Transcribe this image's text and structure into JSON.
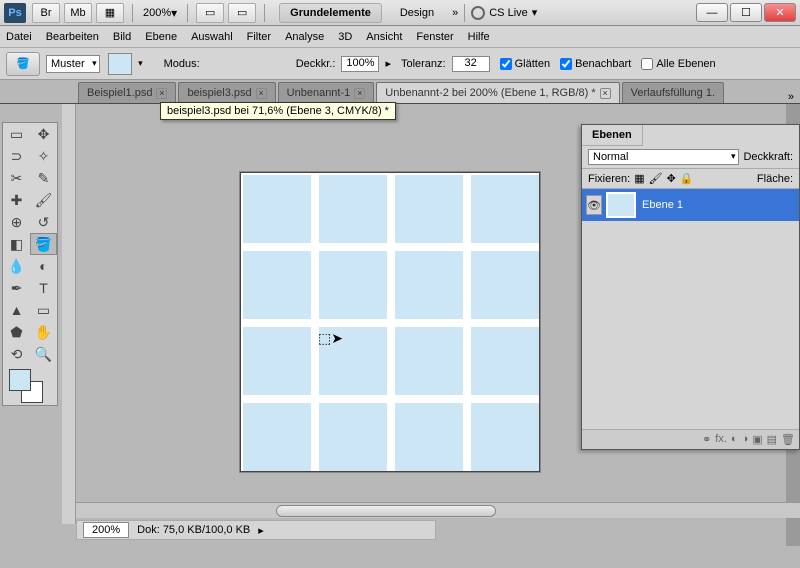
{
  "app": {
    "icon": "Ps"
  },
  "titlebar": {
    "br": "Br",
    "mb": "Mb",
    "zoom": "200%",
    "workspace_primary": "Grundelemente",
    "workspace_secondary": "Design",
    "cslive": "CS Live"
  },
  "menu": {
    "file": "Datei",
    "edit": "Bearbeiten",
    "image": "Bild",
    "layer": "Ebene",
    "select": "Auswahl",
    "filter": "Filter",
    "analysis": "Analyse",
    "d3d": "3D",
    "view": "Ansicht",
    "window": "Fenster",
    "help": "Hilfe"
  },
  "options": {
    "pattern_label": "Muster",
    "mode_label": "Modus:",
    "opacity_label": "Deckkr.:",
    "opacity_value": "100%",
    "tolerance_label": "Toleranz:",
    "tolerance_value": "32",
    "antialias": "Glätten",
    "contiguous": "Benachbart",
    "alllayers": "Alle Ebenen"
  },
  "tabs": [
    {
      "label": "Beispiel1.psd",
      "close": true
    },
    {
      "label": "beispiel3.psd",
      "close": true
    },
    {
      "label": "Unbenannt-1",
      "close": true
    },
    {
      "label": "Unbenannt-2 bei 200% (Ebene 1, RGB/8) *",
      "close": true,
      "active": true
    },
    {
      "label": "Verlaufsfüllung 1.",
      "close": false
    }
  ],
  "tooltip": "beispiel3.psd bei 71,6% (Ebene 3, CMYK/8) *",
  "layers_panel": {
    "title": "Ebenen",
    "mode": "Normal",
    "opacity_label": "Deckkraft:",
    "lock_label": "Fixieren:",
    "fill_label": "Fläche:",
    "layer1": "Ebene 1"
  },
  "status": {
    "zoom": "200%",
    "doc": "Dok: 75,0 KB/100,0 KB"
  }
}
